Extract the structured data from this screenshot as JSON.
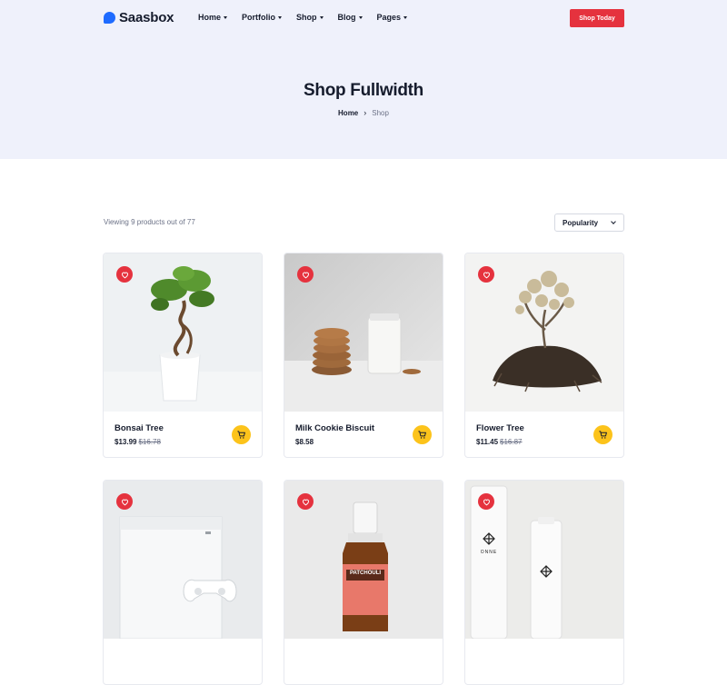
{
  "header": {
    "brand": "Saasbox",
    "nav": [
      {
        "label": "Home"
      },
      {
        "label": "Portfolio"
      },
      {
        "label": "Shop"
      },
      {
        "label": "Blog"
      },
      {
        "label": "Pages"
      }
    ],
    "cta_label": "Shop Today"
  },
  "hero": {
    "title": "Shop Fullwidth",
    "breadcrumb": {
      "home": "Home",
      "separator": "›",
      "current": "Shop"
    }
  },
  "toolbar": {
    "result_count": "Viewing 9 products out of 77",
    "sort_selected": "Popularity"
  },
  "products": [
    {
      "name": "Bonsai Tree",
      "price": "$13.99",
      "old_price": "$16.78",
      "image_icon": "bonsai-tree-image"
    },
    {
      "name": "Milk Cookie Biscuit",
      "price": "$8.58",
      "old_price": "",
      "image_icon": "milk-cookie-image"
    },
    {
      "name": "Flower Tree",
      "price": "$11.45",
      "old_price": "$16.87",
      "image_icon": "flower-tree-image"
    },
    {
      "name": "",
      "price": "",
      "old_price": "",
      "image_icon": "game-console-image"
    },
    {
      "name": "",
      "price": "",
      "old_price": "",
      "image_icon": "essential-oil-image",
      "label_text": "PATCHOULI"
    },
    {
      "name": "",
      "price": "",
      "old_price": "",
      "image_icon": "skincare-bottles-image",
      "label_text": "ONNE"
    }
  ],
  "icons": {
    "wishlist": "heart-icon",
    "cart": "cart-icon",
    "sort": "chevron-down-icon"
  },
  "colors": {
    "accent_red": "#e5323e",
    "cart_yellow": "#fcc31b",
    "hero_bg": "#eff1fb",
    "brand_blue": "#1e6bff"
  }
}
